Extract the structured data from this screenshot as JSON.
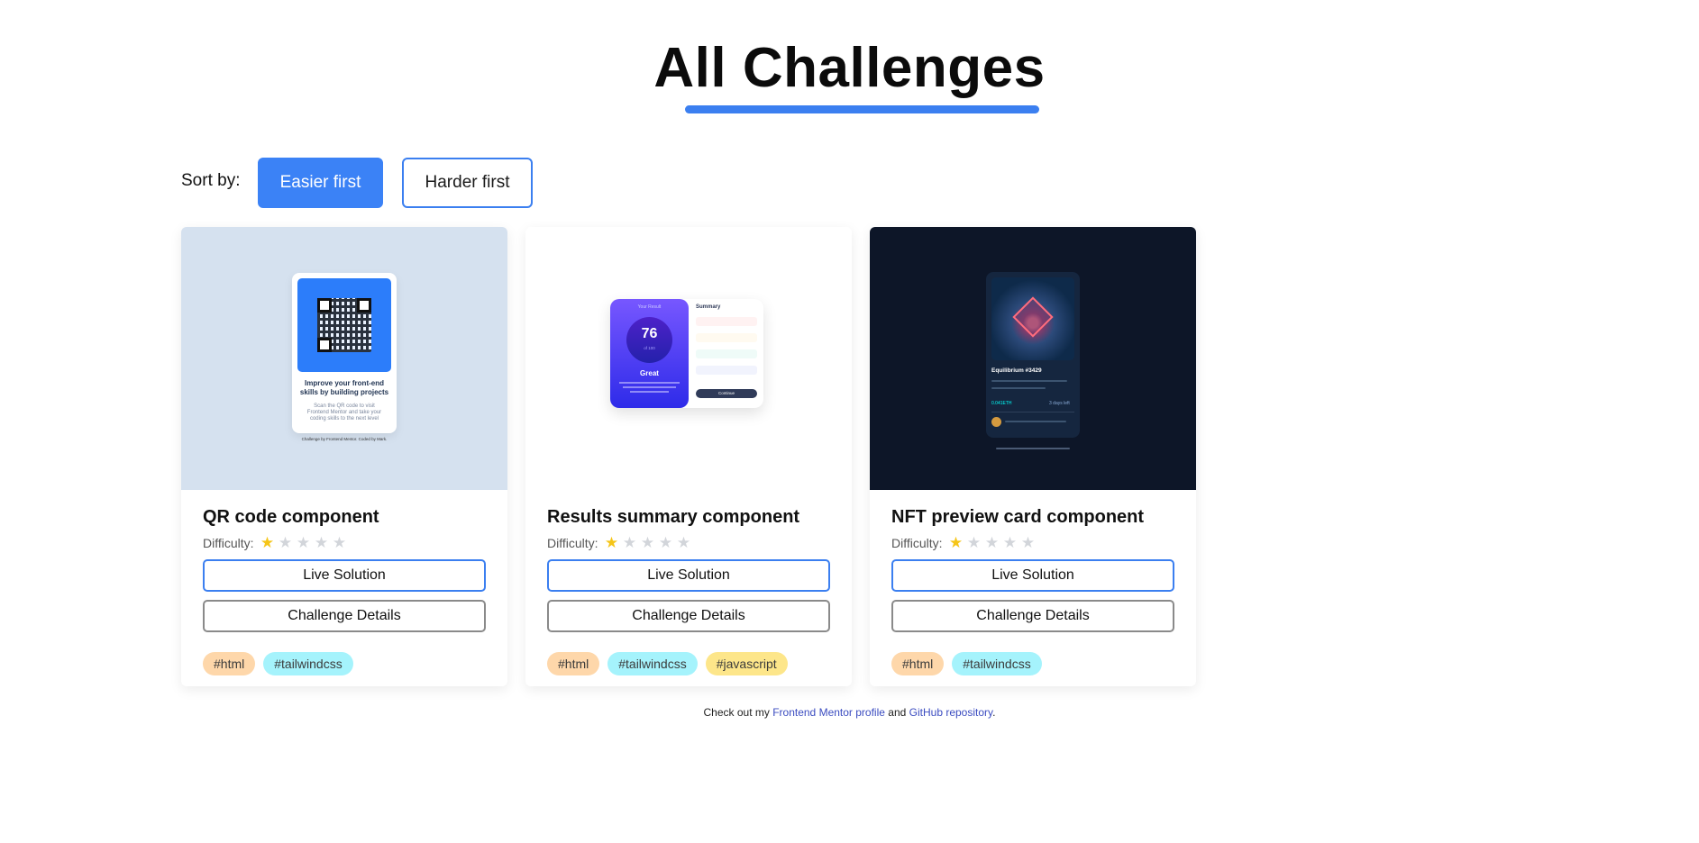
{
  "page": {
    "title": "All Challenges"
  },
  "sort": {
    "label": "Sort by:",
    "options": [
      "Easier first",
      "Harder first"
    ],
    "active": "Easier first"
  },
  "difficulty_label": "Difficulty:",
  "cards": [
    {
      "title": "QR code component",
      "difficulty": 1,
      "difficulty_max": 5,
      "live_label": "Live Solution",
      "details_label": "Challenge Details",
      "tags": [
        "#html",
        "#tailwindcss"
      ],
      "preview": {
        "heading": "Improve your front-end skills by building projects",
        "text": "Scan the QR code to visit Frontend Mentor and take your coding skills to the next level",
        "attribution": "Challenge by Frontend Mentor. Coded by Mark."
      }
    },
    {
      "title": "Results summary component",
      "difficulty": 1,
      "difficulty_max": 5,
      "live_label": "Live Solution",
      "details_label": "Challenge Details",
      "tags": [
        "#html",
        "#tailwindcss",
        "#javascript"
      ],
      "preview": {
        "result_label": "Your Result",
        "score": "76",
        "score_of": "of 100",
        "grade": "Great",
        "summary_label": "Summary",
        "continue_label": "Continue"
      }
    },
    {
      "title": "NFT preview card component",
      "difficulty": 1,
      "difficulty_max": 5,
      "live_label": "Live Solution",
      "details_label": "Challenge Details",
      "tags": [
        "#html",
        "#tailwindcss"
      ],
      "preview": {
        "name": "Equilibrium #3429",
        "price": "0.041ETH",
        "days_left": "3 days left"
      }
    }
  ],
  "footer": {
    "prefix": "Check out my",
    "profile_link": "Frontend Mentor profile",
    "middle": "and",
    "repo_link": "GitHub repository",
    "suffix": "."
  },
  "colors": {
    "accent": "#3b82f6",
    "tag_html": "#fed7aa",
    "tag_tailwind": "#a5f3fc",
    "tag_javascript": "#fde68a",
    "star_on": "#f5c518",
    "star_off": "#d2d5da"
  },
  "icons": [
    "star-icon",
    "arrow-up-icon",
    "clock-icon"
  ]
}
